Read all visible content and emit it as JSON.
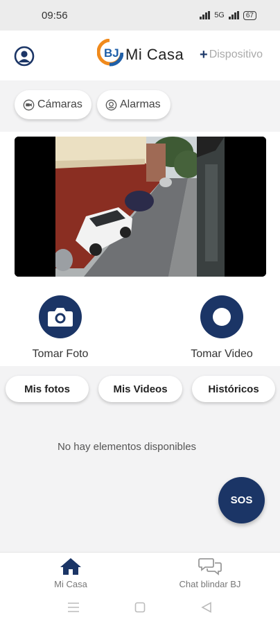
{
  "status_bar": {
    "time": "09:56",
    "network": "5G",
    "battery": "67"
  },
  "header": {
    "title": "Mi Casa",
    "add_device": "Dispositivo",
    "profile_icon": "user-circle-icon"
  },
  "filters": [
    {
      "label": "Cámaras",
      "icon": "camera-icon"
    },
    {
      "label": "Alarmas",
      "icon": "alarm-icon"
    }
  ],
  "actions": {
    "photo_label": "Tomar Foto",
    "video_label": "Tomar Video"
  },
  "tabs": [
    "Mis fotos",
    "Mis Videos",
    "Históricos"
  ],
  "empty_message": "No hay elementos disponibles",
  "sos_label": "SOS",
  "bottom_nav": [
    {
      "label": "Mi Casa",
      "icon": "home-icon"
    },
    {
      "label": "Chat blindar BJ",
      "icon": "chat-icon"
    }
  ],
  "colors": {
    "primary": "#1b3566",
    "logo_orange": "#f08a1c",
    "logo_blue": "#1f5fa8"
  }
}
